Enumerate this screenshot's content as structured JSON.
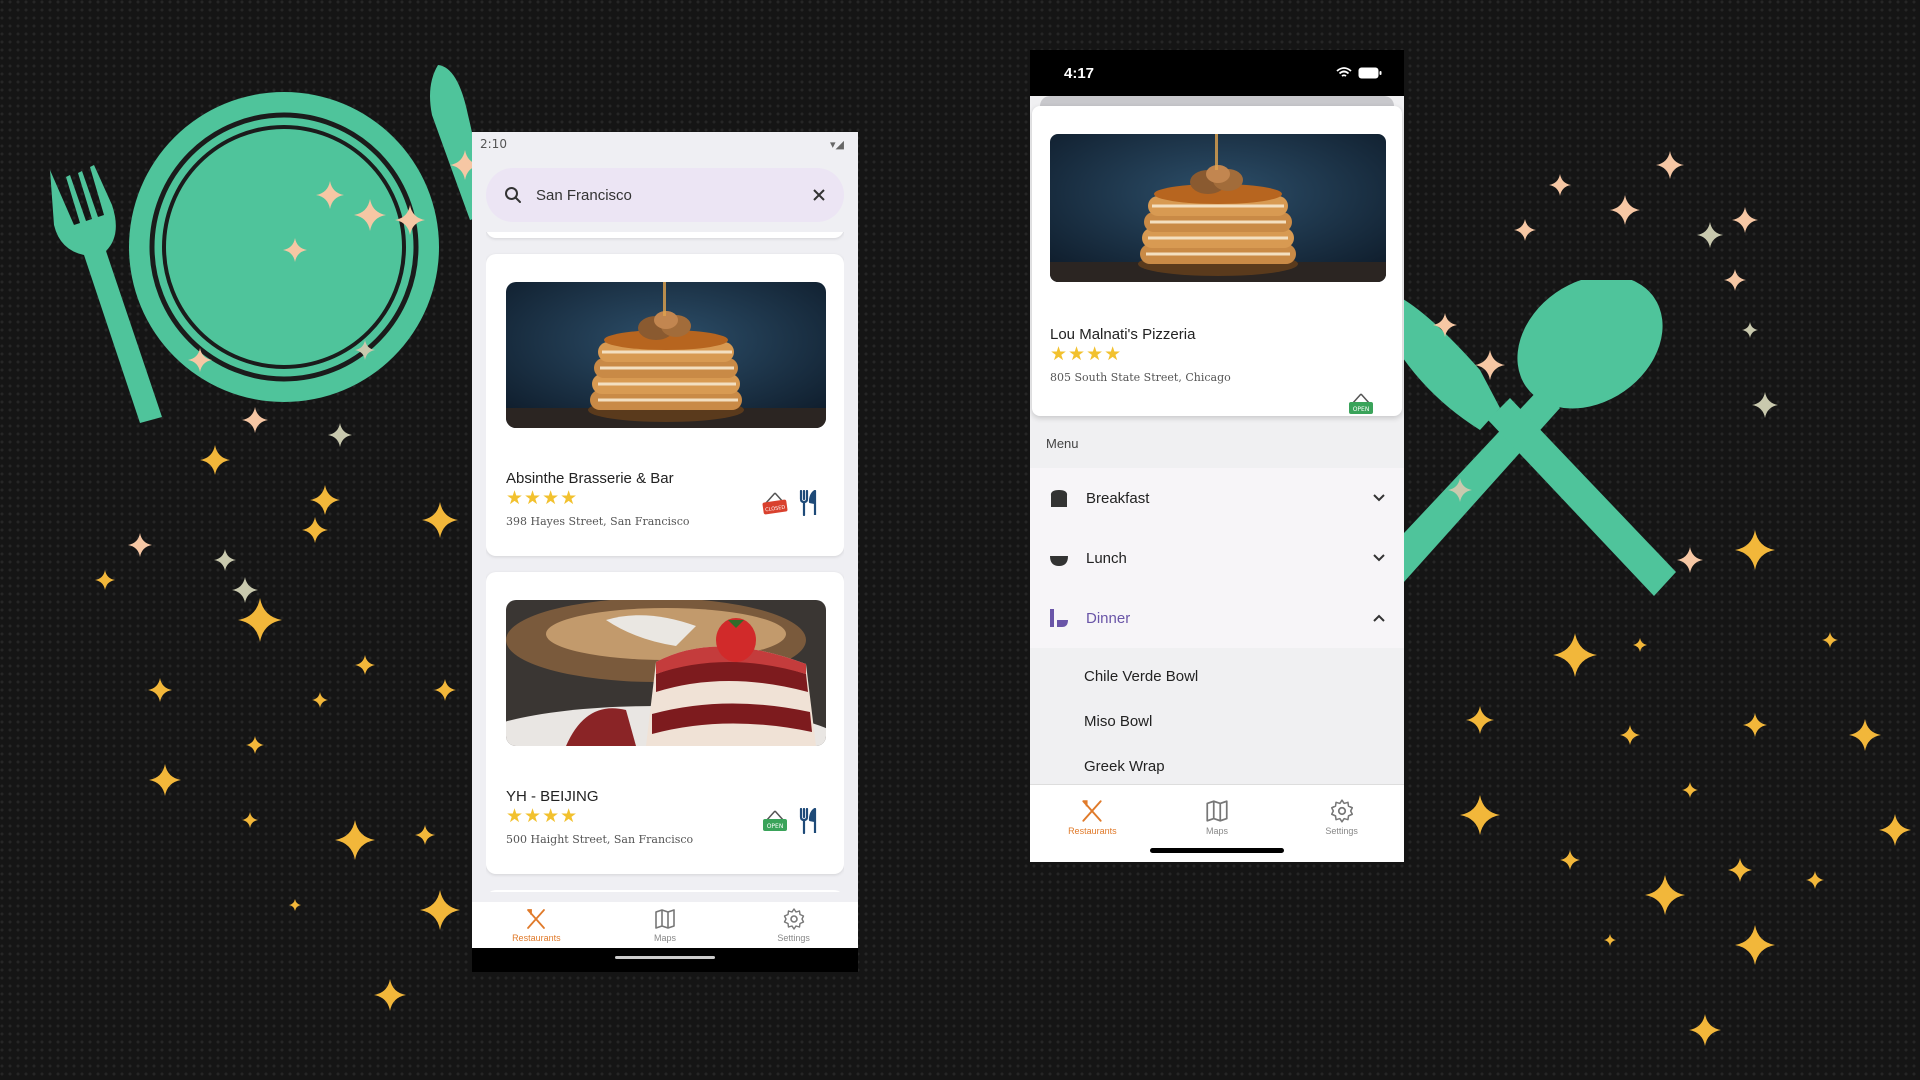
{
  "colors": {
    "accent": "#e07a2a",
    "mint": "#4fc49b",
    "purple": "#6a55a8",
    "star": "#f2c12e"
  },
  "android": {
    "status_time": "2:10",
    "search": {
      "value": "San Francisco",
      "search_icon": "search-icon",
      "clear_icon": "close-icon"
    },
    "restaurants": [
      {
        "name": "Absinthe Brasserie & Bar",
        "stars": "★★★★",
        "address": "398 Hayes Street, San Francisco",
        "status_sign": "CLOSED",
        "image": "pancakes"
      },
      {
        "name": "YH - BEIJING",
        "stars": "★★★★",
        "address": "500 Haight Street, San Francisco",
        "status_sign": "OPEN",
        "image": "cake"
      }
    ],
    "nav": [
      {
        "label": "Restaurants",
        "icon": "utensils-crossed-icon",
        "active": true
      },
      {
        "label": "Maps",
        "icon": "map-icon",
        "active": false
      },
      {
        "label": "Settings",
        "icon": "gear-icon",
        "active": false
      }
    ]
  },
  "ios": {
    "status_time": "4:17",
    "restaurant": {
      "name": "Lou Malnati's Pizzeria",
      "stars": "★★★★",
      "address": "805 South State Street, Chicago",
      "status_sign": "OPEN"
    },
    "menu_label": "Menu",
    "sections": [
      {
        "label": "Breakfast",
        "icon": "toast-icon",
        "expanded": false
      },
      {
        "label": "Lunch",
        "icon": "bowl-icon",
        "expanded": false
      },
      {
        "label": "Dinner",
        "icon": "dinner-icon",
        "expanded": true
      }
    ],
    "dinner_items": [
      "Chile Verde Bowl",
      "Miso Bowl",
      "Greek Wrap"
    ],
    "nav": [
      {
        "label": "Restaurants",
        "icon": "utensils-crossed-icon",
        "active": true
      },
      {
        "label": "Maps",
        "icon": "map-icon",
        "active": false
      },
      {
        "label": "Settings",
        "icon": "gear-icon",
        "active": false
      }
    ]
  }
}
